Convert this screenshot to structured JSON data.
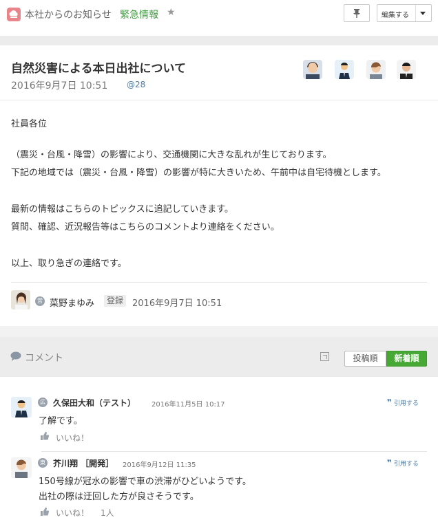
{
  "topbar": {
    "breadcrumb": "本社からのお知らせ",
    "category": "緊急情報",
    "edit_label": "編集する",
    "icons": [
      "app-icon",
      "star-icon",
      "pin-icon",
      "caret-down-icon"
    ]
  },
  "post": {
    "title": "自然災害による本日出社について",
    "date": "2016年9月7日 10:51",
    "views": "@28",
    "body": [
      "社員各位",
      "（震災・台風・降雪）の影響により、交通機関に大きな乱れが生じております。",
      "下記の地域では（震災・台風・降雪）の影響が特に大きいため、午前中は自宅待機とします。",
      "最新の情報はこちらのトピックスに追記していきます。",
      "質問、確認、近況報告等はこちらのコメントより連絡をください。",
      "以上、取り急ぎの連絡です。"
    ],
    "author": {
      "badge": "営",
      "name": "菜野まゆみ",
      "registered_label": "登録",
      "date": "2016年9月7日 10:51"
    }
  },
  "comments": {
    "title": "コメント",
    "sort_old": "投稿順",
    "sort_new": "新着順",
    "items": [
      {
        "badge": "広",
        "name": "久保田大和（テスト）",
        "date": "2016年11月5日 10:17",
        "quote": "引用する",
        "lines": [
          "了解です。"
        ],
        "like": "いいね！",
        "like_count": ""
      },
      {
        "badge": "東",
        "name": "芥川翔 ［開発］",
        "date": "2016年9月12日 11:35",
        "quote": "引用する",
        "lines": [
          "150号線が冠水の影響で車の渋滞がひどいようです。",
          "出社の際は迂回した方が良さそうです。"
        ],
        "like": "いいね！",
        "like_count": "1人"
      }
    ]
  },
  "colors": {
    "accent_green": "#48a836",
    "category_green": "#3d9a3d",
    "link_blue": "#4a7ea8",
    "app_icon": "#e9848a"
  }
}
